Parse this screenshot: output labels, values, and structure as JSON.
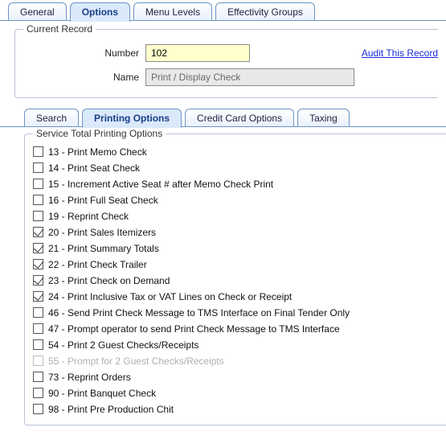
{
  "top_tabs": {
    "general": "General",
    "options": "Options",
    "menu_levels": "Menu Levels",
    "effectivity_groups": "Effectivity Groups"
  },
  "current_record": {
    "group_title": "Current Record",
    "number_label": "Number",
    "number_value": "102",
    "name_label": "Name",
    "name_value": "Print / Display Check",
    "audit_link": "Audit This Record"
  },
  "sub_tabs": {
    "search": "Search",
    "printing_options": "Printing Options",
    "credit_card_options": "Credit Card Options",
    "taxing": "Taxing"
  },
  "options_group": {
    "title": "Service Total Printing Options",
    "items": [
      {
        "label": "13 - Print Memo Check",
        "checked": false,
        "disabled": false
      },
      {
        "label": "14 - Print Seat Check",
        "checked": false,
        "disabled": false
      },
      {
        "label": "15 - Increment Active Seat # after Memo Check Print",
        "checked": false,
        "disabled": false
      },
      {
        "label": "16 - Print Full Seat Check",
        "checked": false,
        "disabled": false
      },
      {
        "label": "19 - Reprint Check",
        "checked": false,
        "disabled": false
      },
      {
        "label": "20 - Print Sales Itemizers",
        "checked": true,
        "disabled": false
      },
      {
        "label": "21 - Print Summary Totals",
        "checked": true,
        "disabled": false
      },
      {
        "label": "22 - Print Check Trailer",
        "checked": true,
        "disabled": false
      },
      {
        "label": "23 - Print Check on Demand",
        "checked": true,
        "disabled": false
      },
      {
        "label": "24 - Print Inclusive Tax or VAT Lines on Check or Receipt",
        "checked": true,
        "disabled": false
      },
      {
        "label": "46 - Send Print Check Message to TMS Interface on Final Tender Only",
        "checked": false,
        "disabled": false
      },
      {
        "label": "47 - Prompt operator to send Print Check Message to TMS Interface",
        "checked": false,
        "disabled": false
      },
      {
        "label": "54 - Print 2 Guest Checks/Receipts",
        "checked": false,
        "disabled": false
      },
      {
        "label": "55 - Prompt for 2 Guest Checks/Receipts",
        "checked": false,
        "disabled": true
      },
      {
        "label": "73 - Reprint Orders",
        "checked": false,
        "disabled": false
      },
      {
        "label": "90 - Print Banquet Check",
        "checked": false,
        "disabled": false
      },
      {
        "label": "98 - Print Pre Production Chit",
        "checked": false,
        "disabled": false
      }
    ]
  }
}
